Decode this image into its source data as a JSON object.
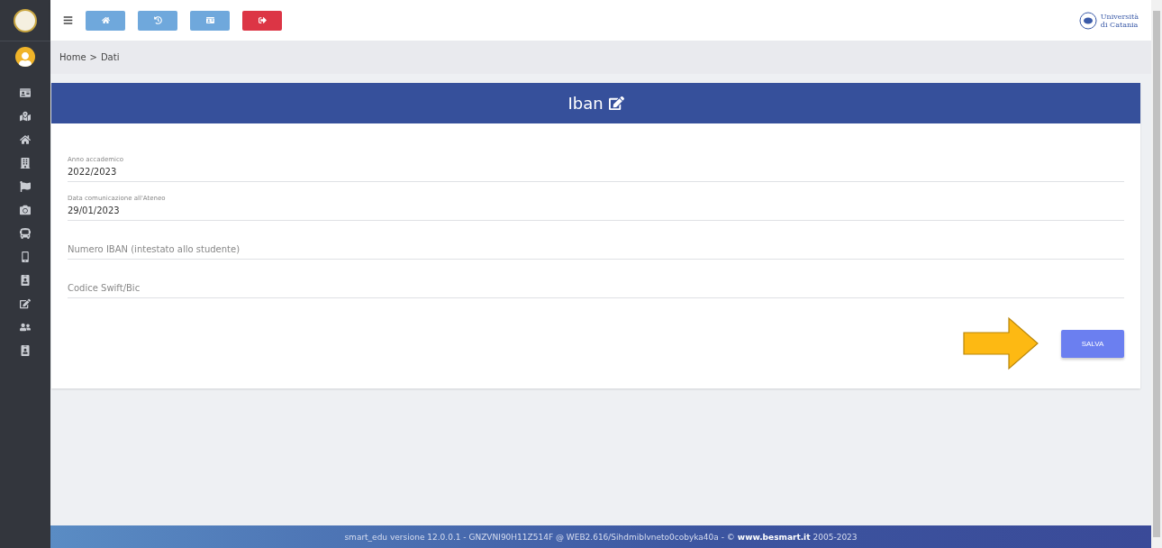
{
  "breadcrumb": {
    "items": [
      "Home",
      "Dati"
    ],
    "separator": ">"
  },
  "card": {
    "title": "Iban"
  },
  "fields": [
    {
      "kind": "filled",
      "label": "Anno accademico",
      "value": "2022/2023"
    },
    {
      "kind": "filled",
      "label": "Data comunicazione all'Ateneo",
      "value": "29/01/2023"
    },
    {
      "kind": "empty",
      "placeholder": "Numero IBAN (intestato allo studente)"
    },
    {
      "kind": "empty",
      "placeholder": "Codice Swift/Bic"
    }
  ],
  "save_button": "SALVA",
  "logo": {
    "line1": "Università",
    "line2": "di Catania"
  },
  "footer": {
    "text": "smart_edu versione 12.0.0.1 - GNZVNI90H11Z514F @ WEB2.616/Sihdmiblvneto0cobyka40a - ©",
    "link": "www.besmart.it",
    "suffix": "2005-2023"
  }
}
